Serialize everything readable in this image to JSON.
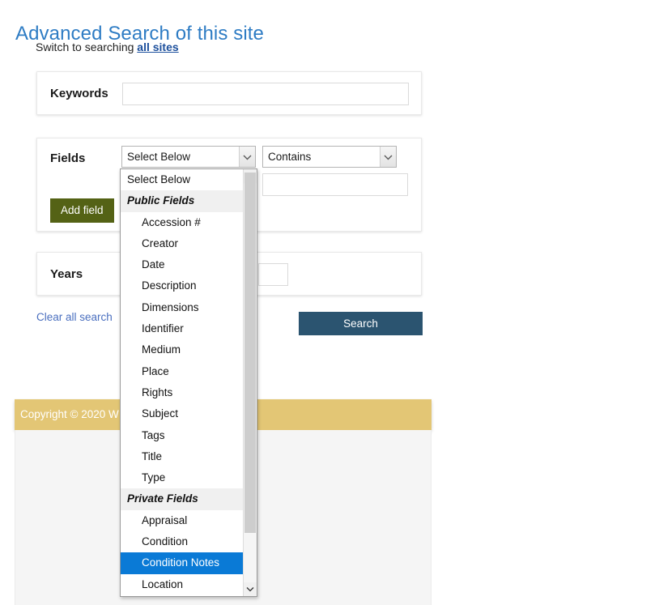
{
  "theme": {
    "accent_gold": "#e3c675",
    "title_blue": "#2e7cc4",
    "link_blue": "#1c4f9c",
    "search_button_bg": "#2b5470",
    "add_field_button_bg": "#546215",
    "highlight_blue": "#0a7ad6"
  },
  "header": {
    "title": "Advanced Search of this site",
    "switch_prefix": "Switch to searching ",
    "switch_link_label": "all sites"
  },
  "keywords": {
    "label": "Keywords",
    "value": "",
    "placeholder": ""
  },
  "fields": {
    "label": "Fields",
    "field_select_value": "Select Below",
    "operator_select_value": "Contains",
    "value_input": "",
    "value_placeholder": "",
    "add_field_label": "Add field"
  },
  "years": {
    "label": "Years",
    "value": "",
    "placeholder": ""
  },
  "actions": {
    "clear_label": "Clear all search",
    "search_label": "Search"
  },
  "footer": {
    "copyright": "Copyright © 2020 W"
  },
  "dropdown": {
    "options": [
      {
        "label": "Select Below",
        "type": "plain",
        "selected": false
      },
      {
        "label": "Public Fields",
        "type": "group",
        "selected": false
      },
      {
        "label": "Accession #",
        "type": "option",
        "selected": false
      },
      {
        "label": "Creator",
        "type": "option",
        "selected": false
      },
      {
        "label": "Date",
        "type": "option",
        "selected": false
      },
      {
        "label": "Description",
        "type": "option",
        "selected": false
      },
      {
        "label": "Dimensions",
        "type": "option",
        "selected": false
      },
      {
        "label": "Identifier",
        "type": "option",
        "selected": false
      },
      {
        "label": "Medium",
        "type": "option",
        "selected": false
      },
      {
        "label": "Place",
        "type": "option",
        "selected": false
      },
      {
        "label": "Rights",
        "type": "option",
        "selected": false
      },
      {
        "label": "Subject",
        "type": "option",
        "selected": false
      },
      {
        "label": "Tags",
        "type": "option",
        "selected": false
      },
      {
        "label": "Title",
        "type": "option",
        "selected": false
      },
      {
        "label": "Type",
        "type": "option",
        "selected": false
      },
      {
        "label": "Private Fields",
        "type": "group",
        "selected": false
      },
      {
        "label": "Appraisal",
        "type": "option",
        "selected": false
      },
      {
        "label": "Condition",
        "type": "option",
        "selected": false
      },
      {
        "label": "Condition Notes",
        "type": "option",
        "selected": true
      },
      {
        "label": "Location",
        "type": "option",
        "selected": false
      }
    ]
  }
}
